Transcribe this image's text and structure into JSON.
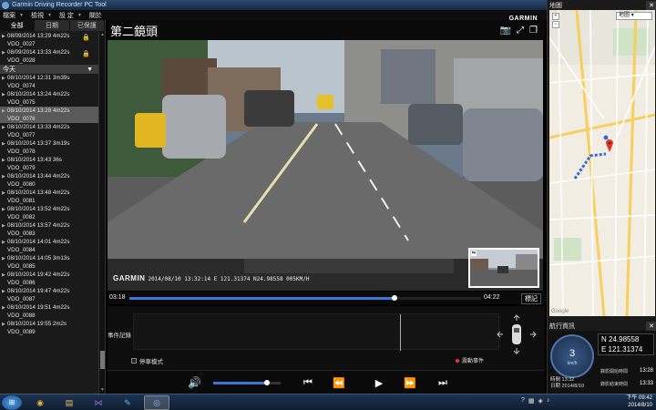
{
  "window": {
    "title": "Garmin Driving Recorder PC Tool",
    "min": "—",
    "max": "□",
    "close": "✕"
  },
  "menu": [
    {
      "label": "檔案"
    },
    {
      "label": "檢視"
    },
    {
      "label": "設 定"
    },
    {
      "label": "關於"
    }
  ],
  "sidebar": {
    "tabs": [
      {
        "label": "全部"
      },
      {
        "label": "日期"
      },
      {
        "label": "已保護"
      }
    ],
    "items": [
      {
        "kind": "video",
        "line1": "08/09/2014 13:29 4m22s",
        "line2": "VDO_0027",
        "locked": true,
        "selected": false
      },
      {
        "kind": "video",
        "line1": "08/09/2014 13:33 4m22s",
        "line2": "VDO_0028",
        "locked": true,
        "selected": false
      },
      {
        "kind": "group",
        "label": "今天"
      },
      {
        "kind": "video",
        "line1": "08/10/2014 12:31 3m39s",
        "line2": "VDO_0074",
        "locked": false,
        "selected": false
      },
      {
        "kind": "video",
        "line1": "08/10/2014 13:24 4m22s",
        "line2": "VDO_0075",
        "locked": false,
        "selected": false
      },
      {
        "kind": "video",
        "line1": "08/10/2014 13:28 4m22s",
        "line2": "VDO_0076",
        "locked": false,
        "selected": true
      },
      {
        "kind": "video",
        "line1": "08/10/2014 13:33 4m22s",
        "line2": "VDO_0077",
        "locked": false,
        "selected": false
      },
      {
        "kind": "video",
        "line1": "08/10/2014 13:37 3m19s",
        "line2": "VDO_0078",
        "locked": false,
        "selected": false
      },
      {
        "kind": "video",
        "line1": "08/10/2014 13:43 36s",
        "line2": "VDO_0079",
        "locked": false,
        "selected": false
      },
      {
        "kind": "video",
        "line1": "08/10/2014 13:44 4m22s",
        "line2": "VDO_0080",
        "locked": false,
        "selected": false
      },
      {
        "kind": "video",
        "line1": "08/10/2014 13:48 4m22s",
        "line2": "VDO_0081",
        "locked": false,
        "selected": false
      },
      {
        "kind": "video",
        "line1": "08/10/2014 13:52 4m22s",
        "line2": "VDO_0082",
        "locked": false,
        "selected": false
      },
      {
        "kind": "video",
        "line1": "08/10/2014 13:57 4m22s",
        "line2": "VDO_0083",
        "locked": false,
        "selected": false
      },
      {
        "kind": "video",
        "line1": "08/10/2014 14:01 4m22s",
        "line2": "VDO_0084",
        "locked": false,
        "selected": false
      },
      {
        "kind": "video",
        "line1": "08/10/2014 14:05 3m13s",
        "line2": "VDO_0085",
        "locked": false,
        "selected": false
      },
      {
        "kind": "video",
        "line1": "08/10/2014 19:42 4m22s",
        "line2": "VDO_0086",
        "locked": false,
        "selected": false
      },
      {
        "kind": "video",
        "line1": "08/10/2014 19:47 4m22s",
        "line2": "VDO_0087",
        "locked": false,
        "selected": false
      },
      {
        "kind": "video",
        "line1": "08/10/2014 19:51 4m22s",
        "line2": "VDO_0088",
        "locked": false,
        "selected": false
      },
      {
        "kind": "video",
        "line1": "08/10/2014 19:55 2m2s",
        "line2": "VDO_0089",
        "locked": false,
        "selected": false
      }
    ]
  },
  "video": {
    "title": "第二鏡頭",
    "brand": "GARMIN",
    "osd": {
      "brand": "GARMIN",
      "text": "2014/08/10 13:32:14  E 121.31374  N24.98558  005KM/H"
    },
    "current_time": "03:18",
    "total_time": "04:22",
    "progress": 0.755,
    "mark_label": "標記",
    "volume": 0.8
  },
  "events": {
    "label": "事件記錄",
    "parking_mode": "停車模式",
    "legend": "震動事件",
    "cursor": 0.73
  },
  "map": {
    "title": "地圖",
    "type_label": "地圖",
    "zoom_in": "+",
    "zoom_out": "−",
    "credit": "Google"
  },
  "info": {
    "title": "航行資訊",
    "speed": "3",
    "speed_unit": "km/h",
    "lat": "N 24.98558",
    "lon": "E 121.31374",
    "time_label": "時間",
    "time_value": "13:32",
    "date_label": "日期",
    "date_value": "2014/8/10",
    "start_label": "錄影開始時間",
    "start_value": "13:28",
    "end_label": "錄影結束時間",
    "end_value": "13:33"
  },
  "taskbar": {
    "start": "⊞",
    "clock_time": "下午 09:42",
    "clock_date": "2014/8/10"
  },
  "colors": {
    "accent": "#3a78d8",
    "route": "#2f6ae0",
    "pin": "#e0382a"
  }
}
